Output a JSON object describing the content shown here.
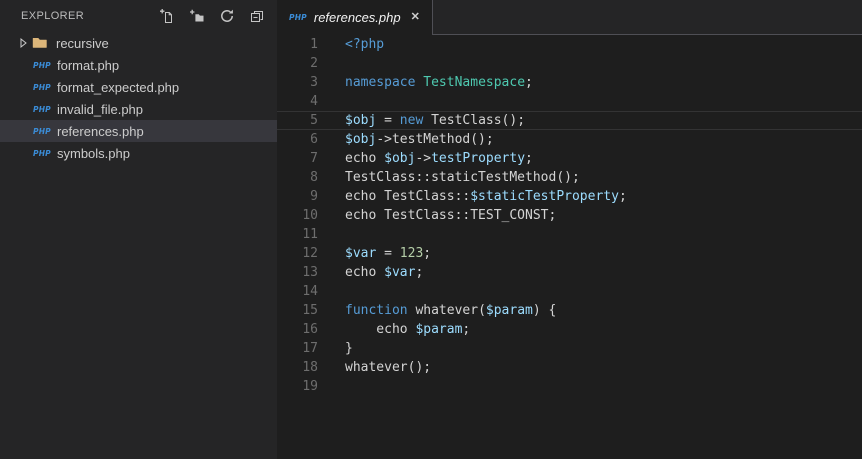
{
  "sidebar": {
    "title": "EXPLORER",
    "toolbar": [
      {
        "name": "new-file-icon"
      },
      {
        "name": "new-folder-icon"
      },
      {
        "name": "refresh-icon"
      },
      {
        "name": "collapse-all-icon"
      }
    ],
    "file_badge": "PHP",
    "items": [
      {
        "label": "recursive",
        "type": "folder",
        "selected": false
      },
      {
        "label": "format.php",
        "type": "php",
        "selected": false
      },
      {
        "label": "format_expected.php",
        "type": "php",
        "selected": false
      },
      {
        "label": "invalid_file.php",
        "type": "php",
        "selected": false
      },
      {
        "label": "references.php",
        "type": "php",
        "selected": true
      },
      {
        "label": "symbols.php",
        "type": "php",
        "selected": false
      }
    ]
  },
  "tab": {
    "title": "references.php",
    "badge": "PHP",
    "close_label": "✕"
  },
  "editor": {
    "active_line": 5,
    "lines": [
      {
        "num": 1,
        "tokens": [
          [
            "kw",
            "<?php"
          ]
        ]
      },
      {
        "num": 2,
        "tokens": []
      },
      {
        "num": 3,
        "tokens": [
          [
            "kw",
            "namespace"
          ],
          [
            "pl",
            " "
          ],
          [
            "cls",
            "TestNamespace"
          ],
          [
            "pl",
            ";"
          ]
        ]
      },
      {
        "num": 4,
        "tokens": []
      },
      {
        "num": 5,
        "tokens": [
          [
            "var",
            "$obj"
          ],
          [
            "pl",
            " = "
          ],
          [
            "kw",
            "new"
          ],
          [
            "pl",
            " TestClass();"
          ]
        ]
      },
      {
        "num": 6,
        "tokens": [
          [
            "var",
            "$obj"
          ],
          [
            "pl",
            "->testMethod();"
          ]
        ]
      },
      {
        "num": 7,
        "tokens": [
          [
            "pl",
            "echo "
          ],
          [
            "var",
            "$obj"
          ],
          [
            "pl",
            "->"
          ],
          [
            "var",
            "testProperty"
          ],
          [
            "pl",
            ";"
          ]
        ]
      },
      {
        "num": 8,
        "tokens": [
          [
            "pl",
            "TestClass::staticTestMethod();"
          ]
        ]
      },
      {
        "num": 9,
        "tokens": [
          [
            "pl",
            "echo TestClass::"
          ],
          [
            "var",
            "$staticTestProperty"
          ],
          [
            "pl",
            ";"
          ]
        ]
      },
      {
        "num": 10,
        "tokens": [
          [
            "pl",
            "echo TestClass::TEST_CONST;"
          ]
        ]
      },
      {
        "num": 11,
        "tokens": []
      },
      {
        "num": 12,
        "tokens": [
          [
            "var",
            "$var"
          ],
          [
            "pl",
            " = "
          ],
          [
            "num",
            "123"
          ],
          [
            "pl",
            ";"
          ]
        ]
      },
      {
        "num": 13,
        "tokens": [
          [
            "pl",
            "echo "
          ],
          [
            "var",
            "$var"
          ],
          [
            "pl",
            ";"
          ]
        ]
      },
      {
        "num": 14,
        "tokens": []
      },
      {
        "num": 15,
        "tokens": [
          [
            "kw",
            "function"
          ],
          [
            "pl",
            " whatever("
          ],
          [
            "var",
            "$param"
          ],
          [
            "pl",
            ") {"
          ]
        ]
      },
      {
        "num": 16,
        "tokens": [
          [
            "pl",
            "    echo "
          ],
          [
            "var",
            "$param"
          ],
          [
            "pl",
            ";"
          ]
        ]
      },
      {
        "num": 17,
        "tokens": [
          [
            "pl",
            "}"
          ]
        ]
      },
      {
        "num": 18,
        "tokens": [
          [
            "pl",
            "whatever();"
          ]
        ]
      },
      {
        "num": 19,
        "tokens": []
      }
    ]
  },
  "colors": {
    "editor_bg": "#1e1e1e",
    "sidebar_bg": "#252526",
    "selected_item_bg": "#37373d",
    "keyword_blue": "#569cd6",
    "variable_blue": "#9cdcfe",
    "class_teal": "#4ec9b0",
    "number_green": "#b5cea8",
    "plain_text": "#d4d4d4",
    "line_number_gray": "#6e6e6e",
    "php_badge_blue": "#3b8dd8",
    "folder_tan": "#dcb67a"
  }
}
